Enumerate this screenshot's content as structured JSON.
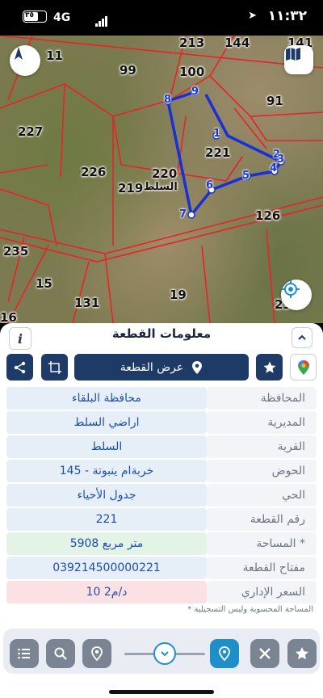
{
  "status_bar": {
    "time": "١١:٣٢",
    "network": "4G",
    "battery_label": "٣٥"
  },
  "map": {
    "parcel_numbers": [
      "213",
      "144",
      "141",
      "11",
      "99",
      "100",
      "91",
      "227",
      "221",
      "226",
      "220",
      "219",
      "235",
      "126",
      "15",
      "131",
      "19",
      "16",
      "23"
    ],
    "town_label": "السلط",
    "vertices": [
      "1",
      "2",
      "3",
      "4",
      "5",
      "6",
      "7",
      "8",
      "9"
    ],
    "compass_label": "N",
    "colors": {
      "boundary": "#e8232a",
      "selection": "#1a2fd6"
    }
  },
  "sheet": {
    "title": "معلومات القطعة",
    "info_label": "i",
    "show_parcel_label": "عرض القطعة",
    "rows": [
      {
        "label": "المحافظة",
        "value": "محافظة البلقاء"
      },
      {
        "label": "المديرية",
        "value": "اراضي السلط"
      },
      {
        "label": "القرية",
        "value": "السلط"
      },
      {
        "label": "الحوض",
        "value": "خربةام ينبوتة - 145"
      },
      {
        "label": "الحي",
        "value": "جدول الأحياء"
      },
      {
        "label": "رقم القطعة",
        "value": "221"
      },
      {
        "label": "المساحة *",
        "value": "5908 متر مربع"
      },
      {
        "label": "مفتاح القطعة",
        "value": "039214500000221"
      },
      {
        "label": "السعر الإداري",
        "value": "10 د/م2"
      }
    ],
    "footnote": "* المساحة المحسوبة وليس التسجيلية"
  },
  "toolbar": {
    "items": [
      "list-icon",
      "search-icon",
      "location-pin-icon",
      "zoom-slider",
      "map-pin-icon",
      "tools-icon",
      "star-icon"
    ]
  }
}
